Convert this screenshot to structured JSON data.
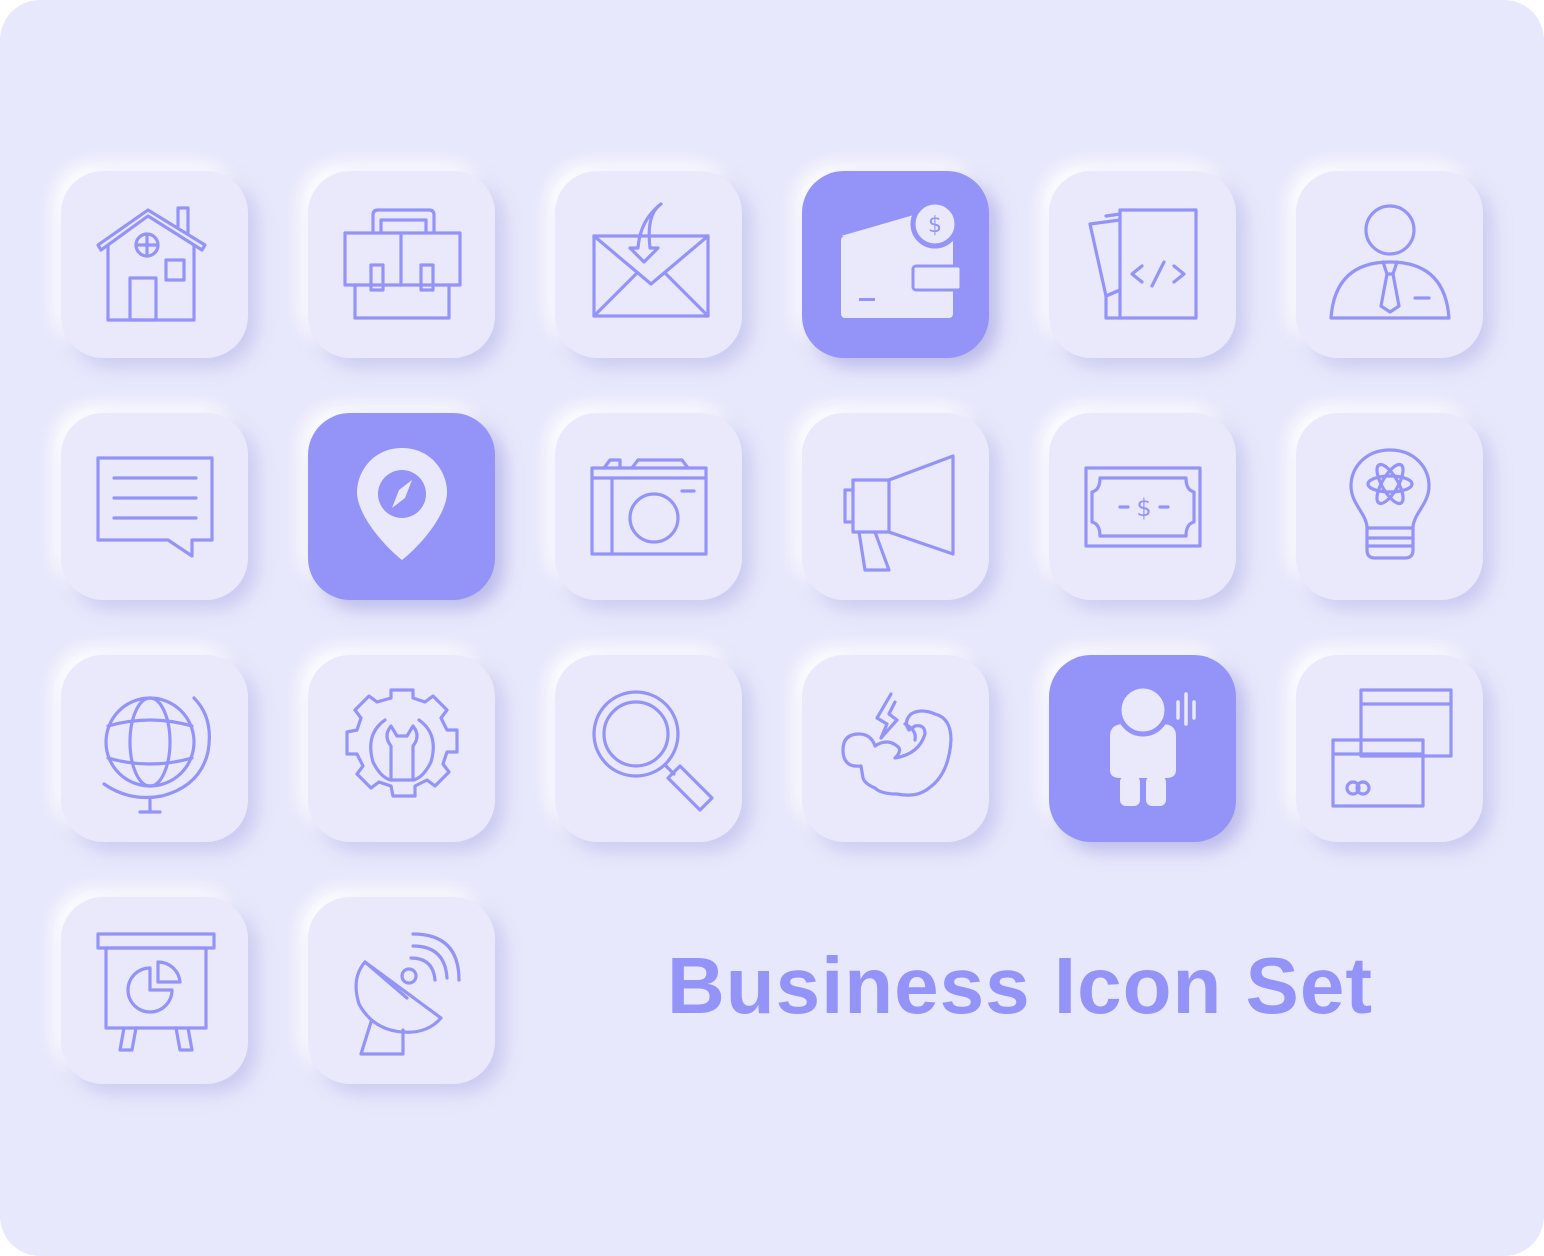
{
  "title": "Business Icon Set",
  "colors": {
    "background": "#e8e8fc",
    "tile": "#e9e9fb",
    "accent": "#9494f8"
  },
  "icons": [
    {
      "name": "house-icon",
      "filled": false
    },
    {
      "name": "briefcase-icon",
      "filled": false
    },
    {
      "name": "incoming-mail-icon",
      "filled": false
    },
    {
      "name": "wallet-dollar-icon",
      "filled": true
    },
    {
      "name": "code-document-icon",
      "filled": false
    },
    {
      "name": "businessman-icon",
      "filled": false
    },
    {
      "name": "chat-message-icon",
      "filled": false
    },
    {
      "name": "location-compass-pin-icon",
      "filled": true
    },
    {
      "name": "camera-icon",
      "filled": false
    },
    {
      "name": "megaphone-icon",
      "filled": false
    },
    {
      "name": "banknote-icon",
      "filled": false
    },
    {
      "name": "idea-bulb-atom-icon",
      "filled": false
    },
    {
      "name": "globe-icon",
      "filled": false
    },
    {
      "name": "gear-wrench-icon",
      "filled": false
    },
    {
      "name": "magnifier-icon",
      "filled": false
    },
    {
      "name": "strength-arm-icon",
      "filled": false
    },
    {
      "name": "speaking-person-icon",
      "filled": true
    },
    {
      "name": "credit-cards-icon",
      "filled": false
    },
    {
      "name": "presentation-board-icon",
      "filled": false
    },
    {
      "name": "satellite-dish-icon",
      "filled": false
    }
  ]
}
